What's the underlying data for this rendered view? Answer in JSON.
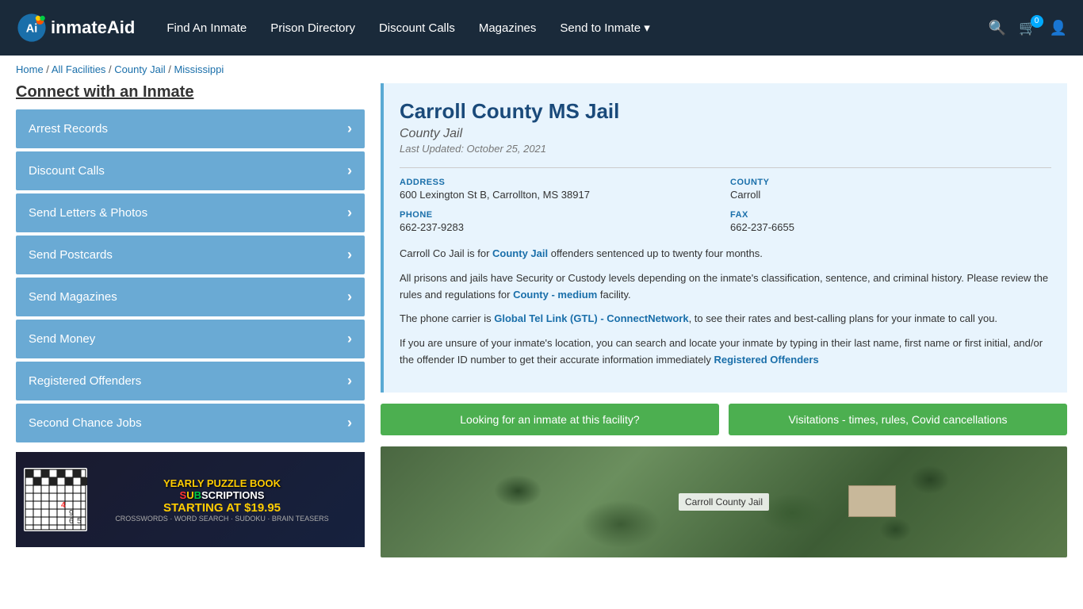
{
  "header": {
    "logo_text": "inmateAid",
    "nav": {
      "find_inmate": "Find An Inmate",
      "prison_directory": "Prison Directory",
      "discount_calls": "Discount Calls",
      "magazines": "Magazines",
      "send_to_inmate": "Send to Inmate ▾"
    },
    "cart_count": "0"
  },
  "breadcrumb": {
    "home": "Home",
    "separator1": " / ",
    "all_facilities": "All Facilities",
    "separator2": " / ",
    "county_jail": "County Jail",
    "separator3": " / ",
    "state": "Mississippi"
  },
  "sidebar": {
    "title": "Connect with an Inmate",
    "items": [
      {
        "label": "Arrest Records",
        "id": "arrest-records"
      },
      {
        "label": "Discount Calls",
        "id": "discount-calls"
      },
      {
        "label": "Send Letters & Photos",
        "id": "send-letters"
      },
      {
        "label": "Send Postcards",
        "id": "send-postcards"
      },
      {
        "label": "Send Magazines",
        "id": "send-magazines"
      },
      {
        "label": "Send Money",
        "id": "send-money"
      },
      {
        "label": "Registered Offenders",
        "id": "registered-offenders"
      },
      {
        "label": "Second Chance Jobs",
        "id": "second-chance-jobs"
      }
    ],
    "arrow": "›",
    "ad": {
      "title_line1": "YEARLY PUZZLE BOOK",
      "title_line2": "SUBSCRIPTIONS",
      "price": "STARTING AT $19.95",
      "types": "CROSSWORDS · WORD SEARCH · SUDOKU · BRAIN TEASERS"
    }
  },
  "facility": {
    "name": "Carroll County MS Jail",
    "type": "County Jail",
    "last_updated": "Last Updated: October 25, 2021",
    "address_label": "ADDRESS",
    "address_value": "600 Lexington St B, Carrollton, MS 38917",
    "county_label": "COUNTY",
    "county_value": "Carroll",
    "phone_label": "PHONE",
    "phone_value": "662-237-9283",
    "fax_label": "FAX",
    "fax_value": "662-237-6655",
    "desc1": "Carroll Co Jail is for ",
    "desc1_link": "County Jail",
    "desc1_end": " offenders sentenced up to twenty four months.",
    "desc2": "All prisons and jails have Security or Custody levels depending on the inmate's classification, sentence, and criminal history. Please review the rules and regulations for ",
    "desc2_link": "County - medium",
    "desc2_end": " facility.",
    "desc3": "The phone carrier is ",
    "desc3_link": "Global Tel Link (GTL) - ConnectNetwork",
    "desc3_end": ", to see their rates and best-calling plans for your inmate to call you.",
    "desc4_start": "If you are unsure of your inmate's location, you can search and locate your inmate by typing in their last name, first name or first initial, and/or the offender ID number to get their accurate information immediately ",
    "desc4_link": "Registered Offenders",
    "btn1": "Looking for an inmate at this facility?",
    "btn2": "Visitations - times, rules, Covid cancellations",
    "map_label": "Carroll County Jail"
  }
}
